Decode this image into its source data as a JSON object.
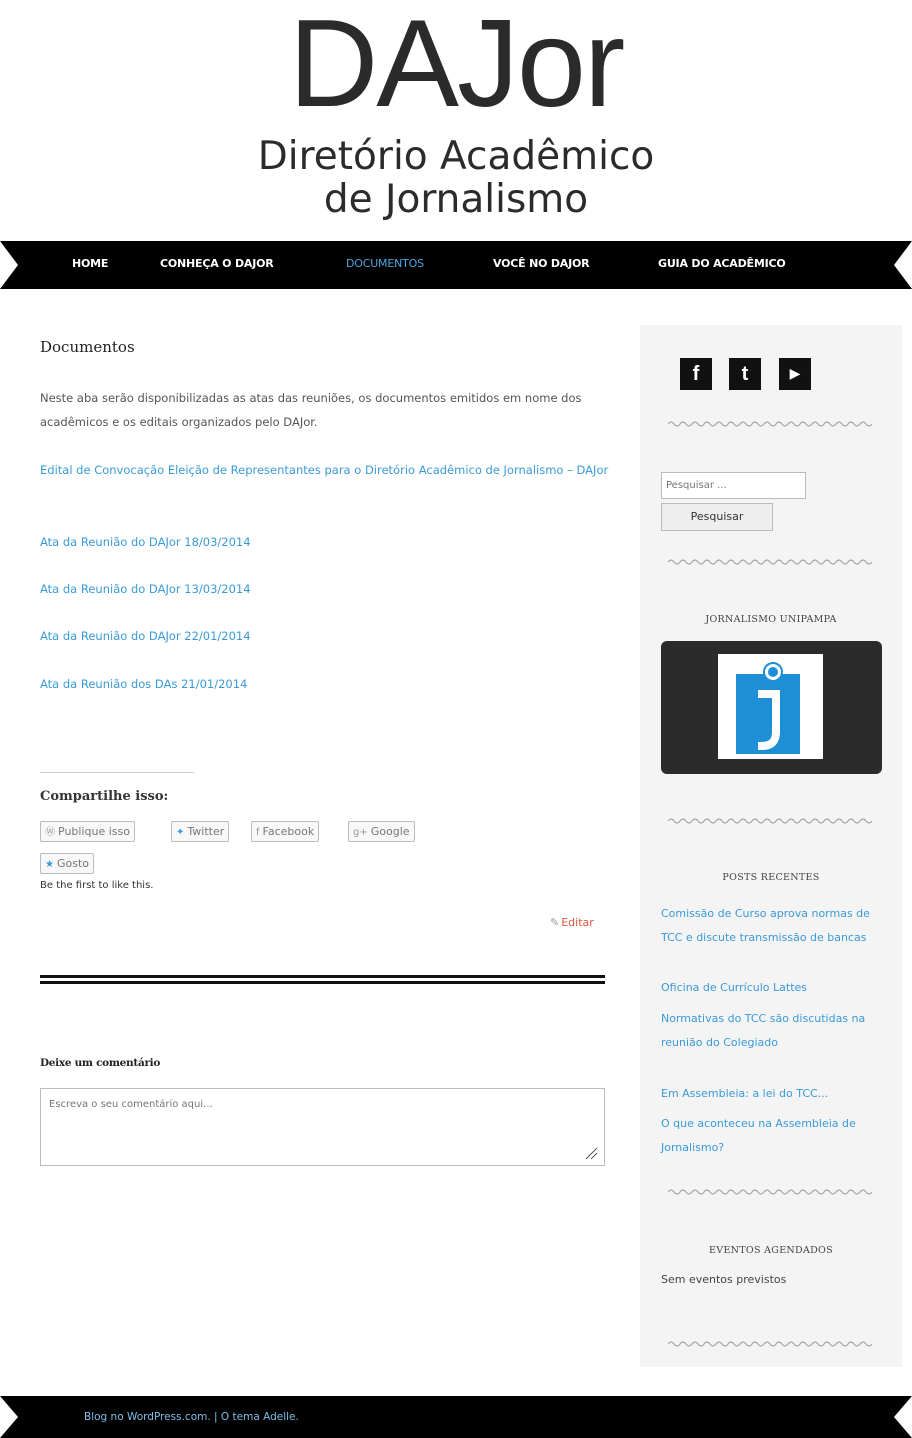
{
  "site": {
    "logo_main": "DAJor",
    "logo_line1": "Diretório Acadêmico",
    "logo_line2": "de Jornalismo"
  },
  "nav": {
    "items": [
      {
        "label": "HOME"
      },
      {
        "label": "CONHEÇA O DAJOR"
      },
      {
        "label": "DOCUMENTOS"
      },
      {
        "label": "VOCÊ NO DAJOR"
      },
      {
        "label": "GUIA DO ACADÊMICO"
      }
    ],
    "active_color": "#4aa8e0"
  },
  "main": {
    "title": "Documentos",
    "intro": "Neste aba serão disponibilizadas as atas das reuniões, os documentos emitidos em nome dos acadêmicos e os editais organizados pelo DAJor.",
    "links": [
      {
        "text": "Edital de Convocação Eleição de Representantes para o Diretório Acadêmico de Jornalismo – DAJor"
      },
      {
        "text": "Ata da Reunião do DAJor 18/03/2014"
      },
      {
        "text": "Ata da Reunião do DAJor 13/03/2014"
      },
      {
        "text": "Ata da Reunião do DAJor 22/01/2014"
      },
      {
        "text": "Ata da Reunião dos DAs 21/01/2014"
      }
    ],
    "link_color": "#3a9ad9"
  },
  "share": {
    "title": "Compartilhe isso:",
    "buttons": [
      {
        "label": "Publique isso",
        "icon": "wordpress-icon"
      },
      {
        "label": "Twitter",
        "icon": "twitter-icon"
      },
      {
        "label": "Facebook",
        "icon": "facebook-icon"
      },
      {
        "label": "Google",
        "icon": "google-plus-icon"
      }
    ],
    "like_label": "Gosto",
    "like_note": "Be the first to like this.",
    "edit_label": "Editar"
  },
  "comment": {
    "title": "Deixe um comentário",
    "placeholder": "Escreva o seu comentário aqui..."
  },
  "sidebar": {
    "social": [
      {
        "icon": "facebook-icon",
        "glyph": "f"
      },
      {
        "icon": "twitter-icon",
        "glyph": "t"
      },
      {
        "icon": "youtube-icon",
        "glyph": "▶"
      }
    ],
    "search_placeholder": "Pesquisar ...",
    "search_button": "Pesquisar",
    "widget1_title": "JORNALISMO UNIPAMPA",
    "widget2_title": "POSTS RECENTES",
    "recent_posts": [
      {
        "text": "Comissão de Curso aprova normas de TCC e discute transmissão de bancas"
      },
      {
        "text": "Oficina de Currículo Lattes"
      },
      {
        "text": "Normativas do TCC são discutidas na reunião do Colegiado"
      },
      {
        "text": "Em Assembleia: a lei do TCC..."
      },
      {
        "text": "O que aconteceu na Assembleia de Jornalismo?"
      }
    ],
    "widget3_title": "EVENTOS AGENDADOS",
    "no_events": "Sem eventos previstos"
  },
  "footer": {
    "blog_link": "Blog no WordPress.com.",
    "separator": " | ",
    "theme_link": "O tema Adelle."
  }
}
